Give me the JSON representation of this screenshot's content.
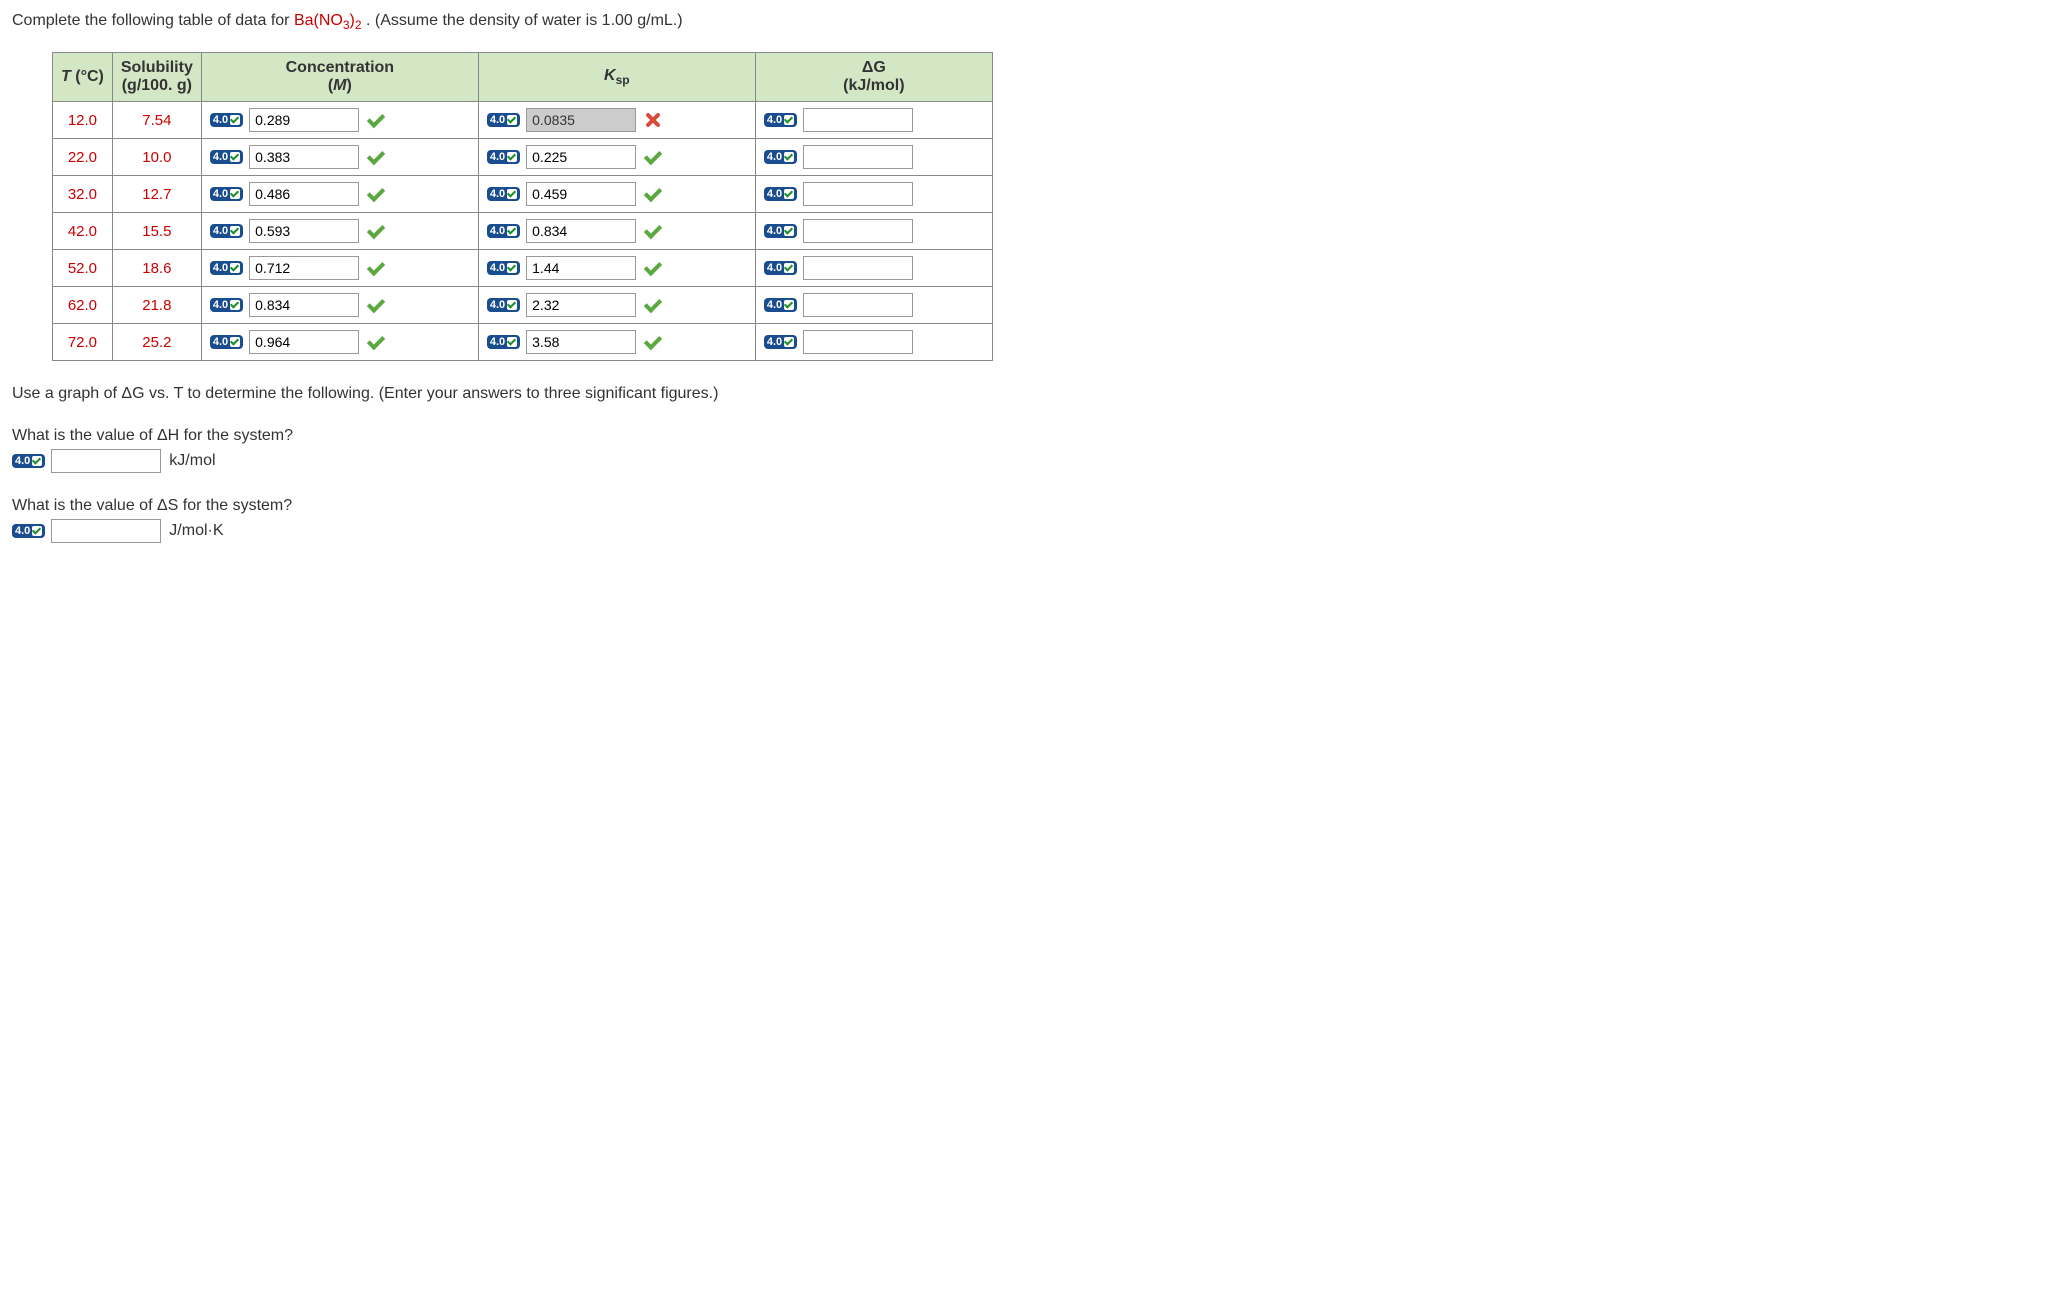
{
  "prompt": {
    "before": "Complete the following table of data for ",
    "compound_html": "Ba(NO<sub>3</sub>)<sub>2</sub>",
    "compound_ba": "Ba(NO",
    "compound_3": "3",
    "compound_close": ")",
    "compound_2": "2",
    "after": ". (Assume the density of water is 1.00 g/mL.)"
  },
  "badge_label": "4.0",
  "headers": {
    "t_line1": "T",
    "t_line2": "(°C)",
    "sol_line1": "Solubility",
    "sol_line2": "(g/100. g)",
    "conc_line1": "Concentration",
    "conc_line2": "(M)",
    "ksp_line1": "K",
    "ksp_sub": "sp",
    "dg_line1": "ΔG",
    "dg_line2": "(kJ/mol)"
  },
  "rows": [
    {
      "t": "12.0",
      "sol": "7.54",
      "conc": "0.289",
      "conc_mark": "check",
      "ksp": "0.0835",
      "ksp_mark": "cross",
      "ksp_disabled": true,
      "dg": ""
    },
    {
      "t": "22.0",
      "sol": "10.0",
      "conc": "0.383",
      "conc_mark": "check",
      "ksp": "0.225",
      "ksp_mark": "check",
      "dg": ""
    },
    {
      "t": "32.0",
      "sol": "12.7",
      "conc": "0.486",
      "conc_mark": "check",
      "ksp": "0.459",
      "ksp_mark": "check",
      "dg": ""
    },
    {
      "t": "42.0",
      "sol": "15.5",
      "conc": "0.593",
      "conc_mark": "check",
      "ksp": "0.834",
      "ksp_mark": "check",
      "dg": ""
    },
    {
      "t": "52.0",
      "sol": "18.6",
      "conc": "0.712",
      "conc_mark": "check",
      "ksp": "1.44",
      "ksp_mark": "check",
      "dg": ""
    },
    {
      "t": "62.0",
      "sol": "21.8",
      "conc": "0.834",
      "conc_mark": "check",
      "ksp": "2.32",
      "ksp_mark": "check",
      "dg": ""
    },
    {
      "t": "72.0",
      "sol": "25.2",
      "conc": "0.964",
      "conc_mark": "check",
      "ksp": "3.58",
      "ksp_mark": "check",
      "dg": ""
    }
  ],
  "graph_prompt": "Use a graph of ΔG vs. T to determine the following. (Enter your answers to three significant figures.)",
  "q1": {
    "text": "What is the value of ΔH for the system?",
    "value": "",
    "unit": "kJ/mol"
  },
  "q2": {
    "text": "What is the value of ΔS for the system?",
    "value": "",
    "unit": "J/mol·K"
  }
}
